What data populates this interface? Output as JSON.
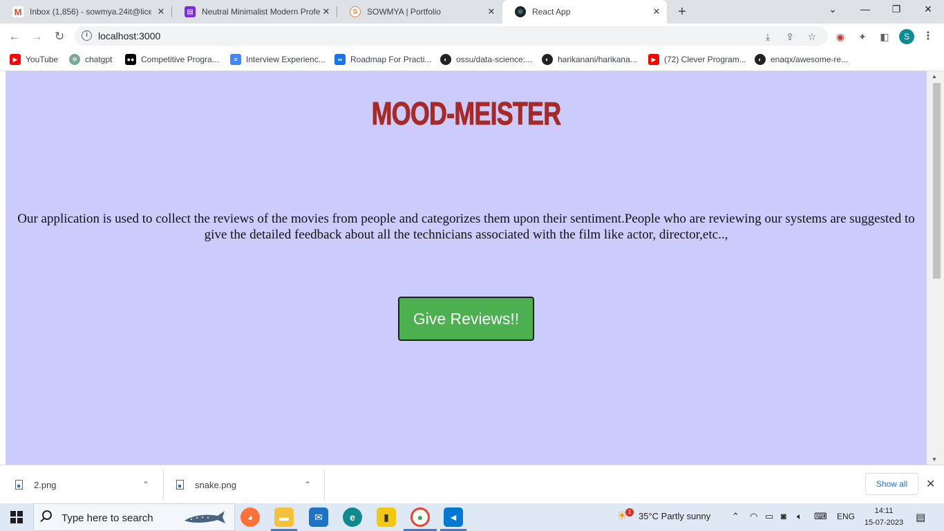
{
  "browser": {
    "tabs": [
      {
        "title": "Inbox (1,856) - sowmya.24it@lice",
        "icon": "gmail-icon",
        "color": "#ea4335"
      },
      {
        "title": "Neutral Minimalist Modern Profe",
        "icon": "canva-doc-icon",
        "color": "#7d2ae8"
      },
      {
        "title": "SOWMYA | Portfolio",
        "icon": "portfolio-s-icon",
        "color": "#f17d32"
      },
      {
        "title": "React App",
        "icon": "react-icon",
        "color": "#222222"
      }
    ],
    "new_tab": "+",
    "window_controls": {
      "minimize": "⌄",
      "restore": "❐",
      "close": "✕"
    },
    "address": "localhost:3000",
    "profile_initial": "S",
    "bookmarks": [
      {
        "label": "YouTube",
        "icon": "youtube-icon",
        "color": "#ff0000"
      },
      {
        "label": "chatgpt",
        "icon": "chatgpt-icon",
        "color": "#7ba797"
      },
      {
        "label": "Competitive Progra...",
        "icon": "medium-icon",
        "color": "#000000"
      },
      {
        "label": "Interview Experienc...",
        "icon": "docs-icon",
        "color": "#4285f4"
      },
      {
        "label": "Roadmap For Practi...",
        "icon": "infinity-icon",
        "color": "#1a73e8"
      },
      {
        "label": "ossu/data-science:...",
        "icon": "github-icon",
        "color": "#222222"
      },
      {
        "label": "harikanani/harikana...",
        "icon": "github-icon",
        "color": "#222222"
      },
      {
        "label": "(72) Clever Program...",
        "icon": "youtube-icon",
        "color": "#ff0000"
      },
      {
        "label": "enaqx/awesome-re...",
        "icon": "github-icon",
        "color": "#222222"
      }
    ]
  },
  "page": {
    "title": "MOOD-MEISTER",
    "description": "Our application is used to collect the reviews of the movies from people and categorizes them upon their sentiment.People who are reviewing our systems are suggested to give the detailed feedback about all the technicians associated with the film like actor, director,etc..,",
    "cta_label": "Give Reviews!!",
    "background": "#ccccfc",
    "title_color": "#a52a2a",
    "button_color": "#4caf50"
  },
  "downloads": {
    "items": [
      {
        "name": "2.png"
      },
      {
        "name": "snake.png"
      }
    ],
    "show_all": "Show all"
  },
  "taskbar": {
    "search_placeholder": "Type here to search",
    "weather": "35°C  Partly sunny",
    "language": "ENG",
    "time": "14:11",
    "date": "15-07-2023",
    "weather_badge": "1"
  }
}
